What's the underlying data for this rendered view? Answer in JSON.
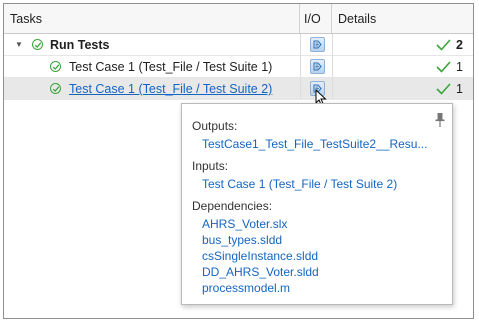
{
  "table": {
    "headers": {
      "tasks": "Tasks",
      "io": "I/O",
      "details": "Details"
    },
    "rows": [
      {
        "label": "Run Tests",
        "count": "2"
      },
      {
        "label": "Test Case 1 (Test_File / Test Suite 1)",
        "count": "1"
      },
      {
        "label": "Test Case 1 (Test_File / Test Suite 2)",
        "count": "1"
      }
    ]
  },
  "popup": {
    "outputs_heading": "Outputs:",
    "outputs": [
      "TestCase1_Test_File_TestSuite2__Resu..."
    ],
    "inputs_heading": "Inputs:",
    "inputs": [
      "Test Case 1 (Test_File / Test Suite 2)"
    ],
    "dependencies_heading": "Dependencies:",
    "dependencies": [
      "AHRS_Voter.slx",
      "bus_types.sldd",
      "csSingleInstance.sldd",
      "DD_AHRS_Voter.sldd",
      "processmodel.m"
    ]
  },
  "icons": {
    "expander": "caret-down-icon",
    "status": "pass-circle-check-icon",
    "io": "io-document-icon",
    "detail": "green-check-icon",
    "pin": "pin-icon",
    "cursor": "mouse-pointer-icon"
  },
  "colors": {
    "pass_green": "#3aa53a",
    "link_blue": "#1565c0",
    "selected_row": "#e8e8e8"
  }
}
